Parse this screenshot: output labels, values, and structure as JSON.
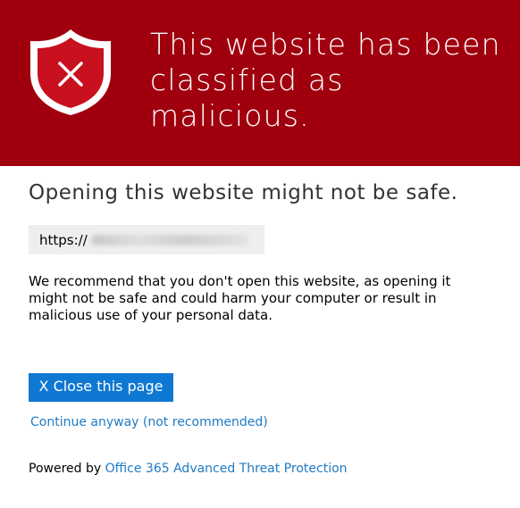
{
  "banner": {
    "title_line1": "This website has been",
    "title_line2": "classified as malicious.",
    "icon": "shield-x-icon",
    "background_color": "#a0000e"
  },
  "main": {
    "subtitle": "Opening this website might not be safe.",
    "url_prefix": "https://",
    "message": "We recommend that you don't open this website, as opening it might not be safe and could harm your computer or result in malicious use of your personal data."
  },
  "actions": {
    "close_label": "X Close this page",
    "close_color": "#0f78d3",
    "continue_label": "Continue anyway (not recommended)",
    "link_color": "#1e7bc5"
  },
  "footer": {
    "powered_prefix": "Powered by",
    "powered_link": "Office 365 Advanced Threat Protection"
  }
}
